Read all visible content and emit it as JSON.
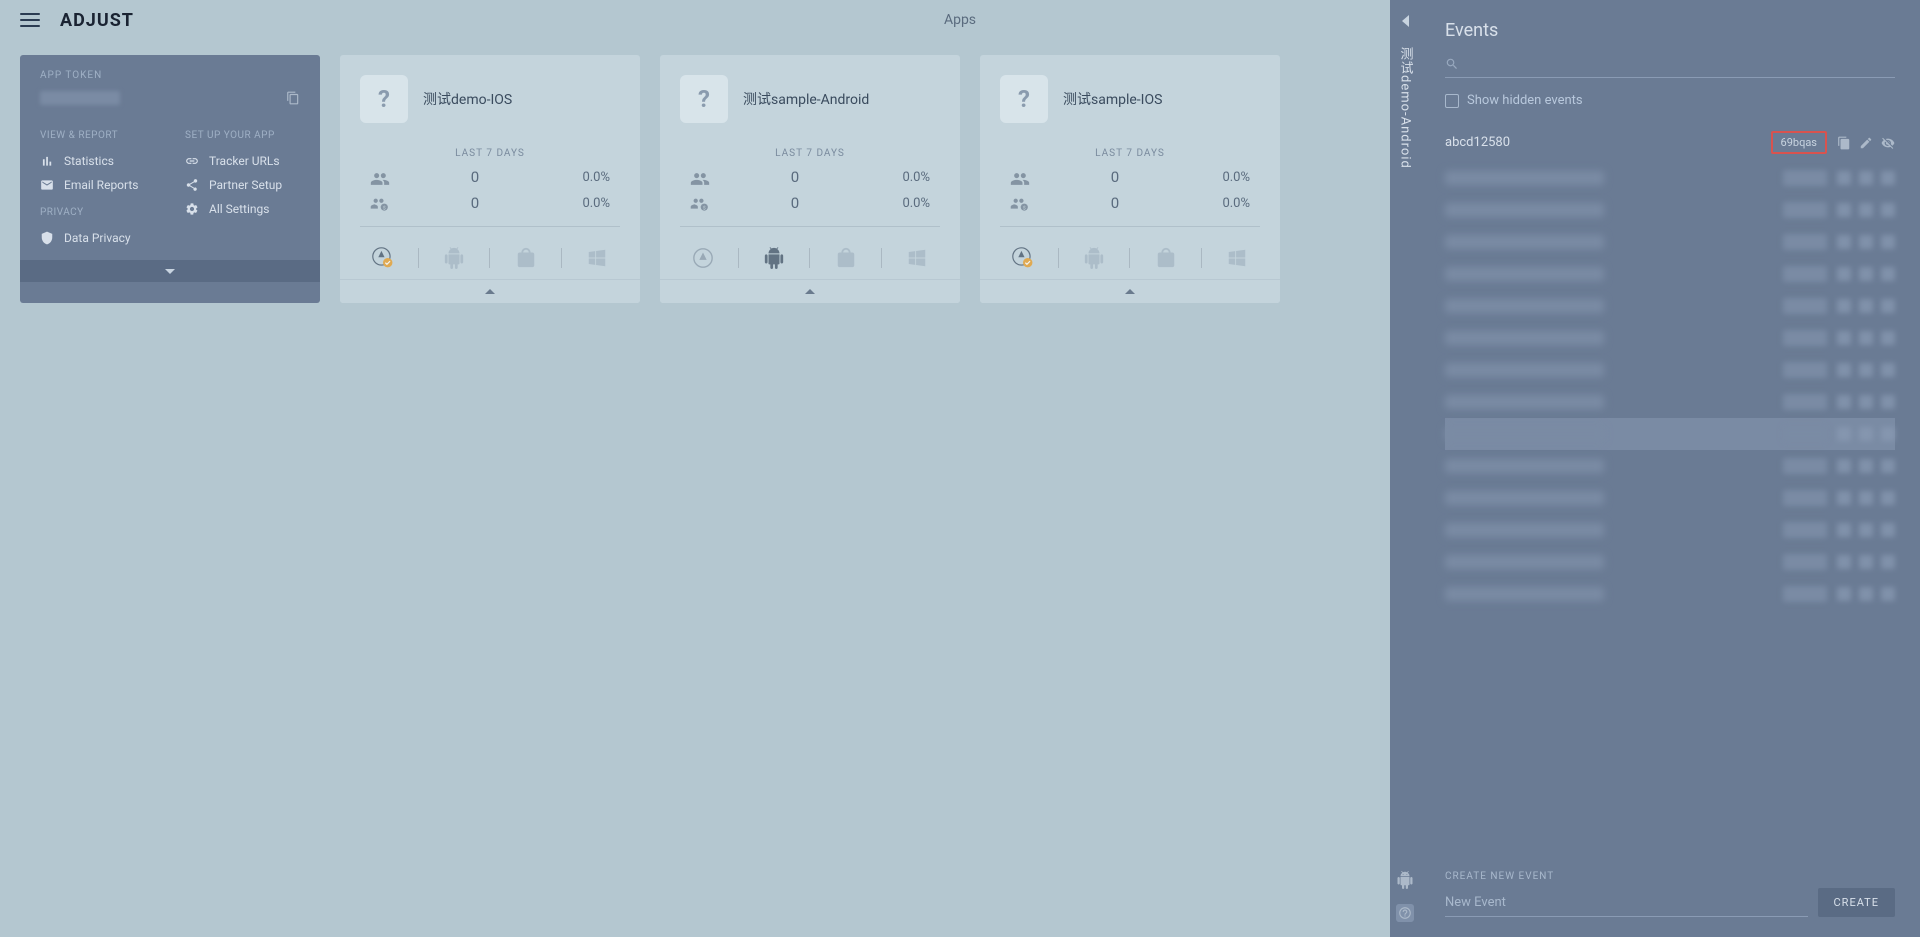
{
  "header": {
    "page_title": "Apps",
    "logo_text": "ADJUST"
  },
  "app_card": {
    "sections": {
      "token_label": "APP TOKEN",
      "view_report_label": "VIEW & REPORT",
      "setup_label": "SET UP YOUR APP",
      "privacy_label": "PRIVACY"
    },
    "view_report_items": [
      {
        "icon": "bar-chart",
        "label": "Statistics"
      },
      {
        "icon": "mail",
        "label": "Email Reports"
      }
    ],
    "setup_items": [
      {
        "icon": "link",
        "label": "Tracker URLs"
      },
      {
        "icon": "share",
        "label": "Partner Setup"
      },
      {
        "icon": "gear",
        "label": "All Settings"
      }
    ],
    "privacy_items": [
      {
        "icon": "shield",
        "label": "Data Privacy"
      }
    ]
  },
  "apps": [
    {
      "name": "测试demo-IOS",
      "stats_label": "LAST 7 DAYS",
      "stats": [
        {
          "icon": "users",
          "value": "0",
          "pct": "0.0%"
        },
        {
          "icon": "dollar",
          "value": "0",
          "pct": "0.0%"
        }
      ],
      "platforms": [
        "appstore-active",
        "android",
        "windows-store",
        "windows"
      ]
    },
    {
      "name": "测试sample-Android",
      "stats_label": "LAST 7 DAYS",
      "stats": [
        {
          "icon": "users",
          "value": "0",
          "pct": "0.0%"
        },
        {
          "icon": "dollar",
          "value": "0",
          "pct": "0.0%"
        }
      ],
      "platforms": [
        "appstore",
        "android-active",
        "windows-store",
        "windows"
      ]
    },
    {
      "name": "测试sample-IOS",
      "stats_label": "LAST 7 DAYS",
      "stats": [
        {
          "icon": "users",
          "value": "0",
          "pct": "0.0%"
        },
        {
          "icon": "dollar",
          "value": "0",
          "pct": "0.0%"
        }
      ],
      "platforms": [
        "appstore-active",
        "android",
        "windows-store",
        "windows"
      ]
    }
  ],
  "side_tab": {
    "label": "测试demo-Android"
  },
  "events_panel": {
    "title": "Events",
    "show_hidden_label": "Show hidden events",
    "events": [
      {
        "name": "abcd12580",
        "token": "69bqas",
        "highlight": true
      },
      {
        "redacted": true
      },
      {
        "redacted": true
      },
      {
        "redacted": true
      },
      {
        "redacted": true
      },
      {
        "redacted": true
      },
      {
        "redacted": true
      },
      {
        "redacted": true
      },
      {
        "redacted": true
      },
      {
        "redacted": true,
        "selected": true
      },
      {
        "redacted": true
      },
      {
        "redacted": true
      },
      {
        "redacted": true
      },
      {
        "redacted": true
      },
      {
        "redacted": true
      }
    ],
    "create_label": "CREATE NEW EVENT",
    "create_placeholder": "New Event",
    "create_button": "CREATE"
  }
}
